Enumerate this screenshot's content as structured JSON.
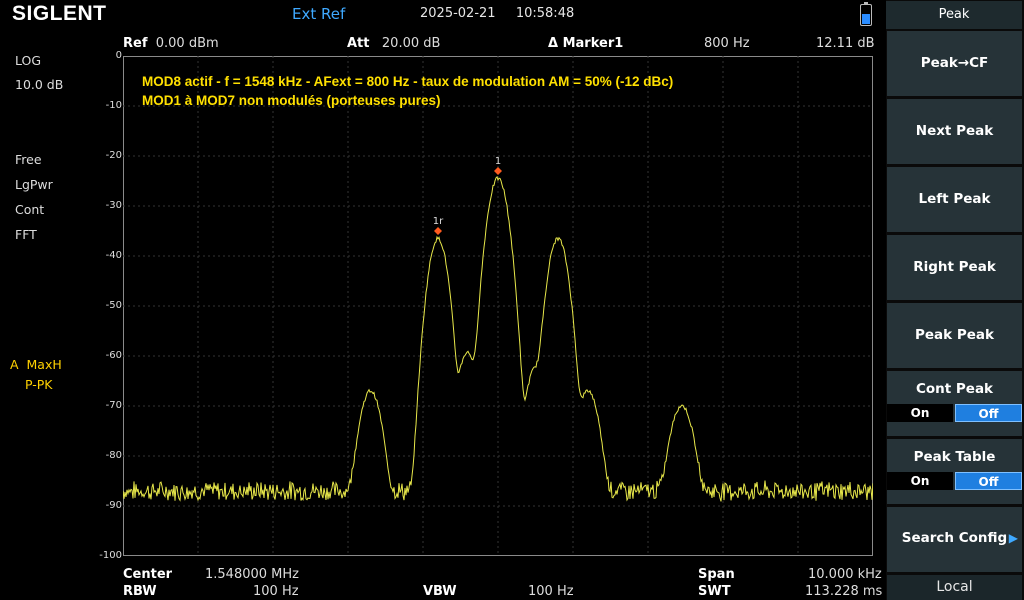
{
  "brand": "SIGLENT",
  "ext_ref": "Ext Ref",
  "date": "2025-02-21",
  "time": "10:58:48",
  "header": {
    "ref_label": "Ref",
    "ref_value": "0.00 dBm",
    "att_label": "Att",
    "att_value": "20.00 dB",
    "marker_label": "Δ Marker1",
    "marker_freq": "800 Hz",
    "marker_level": "12.11 dB"
  },
  "left_panel": {
    "scale_type": "LOG",
    "scale_div": "10.0 dB",
    "trigger": "Free",
    "avg_type": "LgPwr",
    "sweep_mode": "Cont",
    "sweep_type": "FFT",
    "trace_id": "A",
    "trace_mode": "MaxH",
    "detector": "P-PK"
  },
  "annotation": {
    "line1": "MOD8 actif - f = 1548 kHz - AFext = 800 Hz - taux de modulation AM = 50% (-12 dBc)",
    "line2": "MOD1 à MOD7 non modulés (porteuses pures)"
  },
  "footer": {
    "center_label": "Center",
    "center_value": "1.548000 MHz",
    "rbw_label": "RBW",
    "rbw_value": "100 Hz",
    "vbw_label": "VBW",
    "vbw_value": "100 Hz",
    "span_label": "Span",
    "span_value": "10.000 kHz",
    "swt_label": "SWT",
    "swt_value": "113.228 ms"
  },
  "softkeys": {
    "menu_title": "Peak",
    "peak_to_cf": "Peak→CF",
    "next_peak": "Next Peak",
    "left_peak": "Left Peak",
    "right_peak": "Right Peak",
    "peak_peak": "Peak Peak",
    "cont_peak": "Cont Peak",
    "cont_peak_on": "On",
    "cont_peak_off": "Off",
    "peak_table": "Peak Table",
    "peak_table_on": "On",
    "peak_table_off": "Off",
    "search_config": "Search Config",
    "local": "Local"
  },
  "chart_data": {
    "type": "line",
    "trace_color": "#e8e84a",
    "xlim": [
      1543000,
      1553000
    ],
    "ylim": [
      -100,
      0
    ],
    "y_ticks": [
      0,
      -10,
      -20,
      -30,
      -40,
      -50,
      -60,
      -70,
      -80,
      -90,
      -100
    ],
    "grid": true,
    "noise_floor_dbm": -87,
    "peaks": [
      {
        "x": 1546300,
        "y": -67,
        "w": 130
      },
      {
        "x": 1547200,
        "y": -67.5,
        "w": 120
      },
      {
        "x": 1547600,
        "y": -62,
        "w": 110
      },
      {
        "x": 1548000,
        "y": -24.5,
        "w": 115
      },
      {
        "x": 1547200,
        "y": -36.5,
        "w": 110
      },
      {
        "x": 1548800,
        "y": -36.5,
        "w": 115
      },
      {
        "x": 1547580,
        "y": -62.5,
        "w": 120
      },
      {
        "x": 1548500,
        "y": -62.5,
        "w": 120
      },
      {
        "x": 1549200,
        "y": -67,
        "w": 130
      },
      {
        "x": 1550450,
        "y": -70,
        "w": 140
      }
    ],
    "markers": [
      {
        "label": "1",
        "x": 1548000,
        "y": -23
      },
      {
        "label": "1r",
        "x": 1547200,
        "y": -35
      }
    ]
  }
}
